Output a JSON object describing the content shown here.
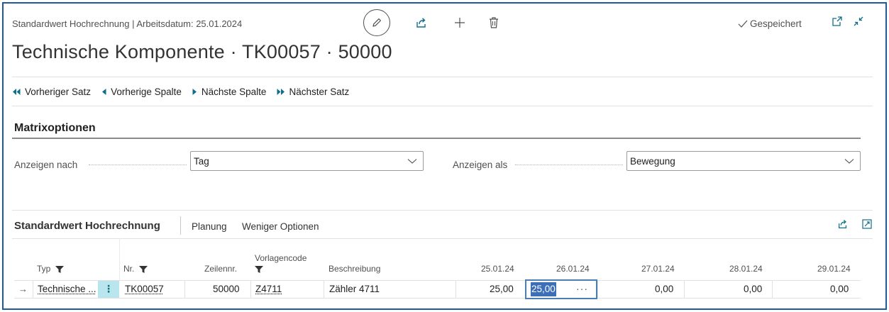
{
  "header": {
    "caption": "Standardwert Hochrechnung | Arbeitsdatum: 25.01.2024",
    "title": "Technische Komponente · TK00057 · 50000",
    "status": "Gespeichert",
    "icons": [
      "pencil-icon",
      "share-icon",
      "plus-icon",
      "trash-icon",
      "checkmark-icon",
      "open-new-window-icon",
      "collapse-icon"
    ]
  },
  "navigation": {
    "prev_record": "Vorheriger Satz",
    "prev_column": "Vorherige Spalte",
    "next_column": "Nächste Spalte",
    "next_record": "Nächster Satz"
  },
  "matrix_options": {
    "title": "Matrixoptionen",
    "show_by_label": "Anzeigen nach",
    "show_by_value": "Tag",
    "show_as_label": "Anzeigen als",
    "show_as_value": "Bewegung"
  },
  "grid": {
    "title": "Standardwert Hochrechnung",
    "actions": [
      "Planung",
      "Weniger Optionen"
    ],
    "columns": {
      "typ": "Typ",
      "nr": "Nr.",
      "zeilennr": "Zeilennr.",
      "vorlagencode": "Vorlagencode",
      "beschreibung": "Beschreibung",
      "d1": "25.01.24",
      "d2": "26.01.24",
      "d3": "27.01.24",
      "d4": "28.01.24",
      "d5": "29.01.24"
    },
    "row": {
      "arrow": "→",
      "typ": "Technische ...",
      "menu": "⋮",
      "nr": "TK00057",
      "zeilennr": "50000",
      "vorlagencode": "Z4711",
      "beschreibung": "Zähler 4711",
      "d1": "25,00",
      "d2": "25,00",
      "d2_more": "···",
      "d3": "0,00",
      "d4": "0,00",
      "d5": "0,00"
    }
  },
  "colors": {
    "frame_border": "#1f5a96",
    "nav_accent": "#0f6f8a",
    "selection": "#3d6fb8",
    "row_menu_bg": "#b9e6ee"
  }
}
